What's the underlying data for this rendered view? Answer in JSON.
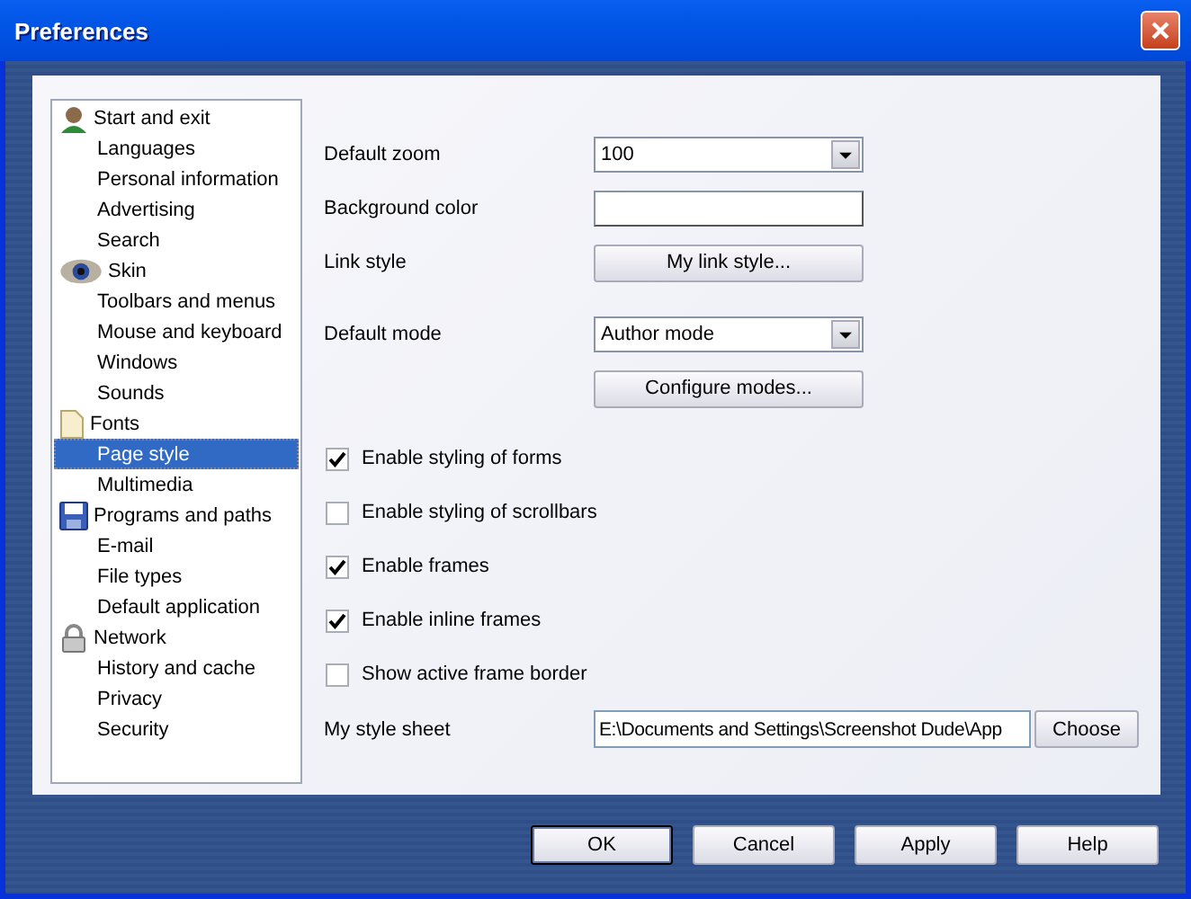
{
  "window": {
    "title": "Preferences"
  },
  "sidebar": {
    "items": [
      {
        "label": "Start and exit",
        "kind": "person",
        "selected": false
      },
      {
        "label": "Languages",
        "kind": "plain",
        "selected": false
      },
      {
        "label": "Personal information",
        "kind": "plain",
        "selected": false
      },
      {
        "label": "Advertising",
        "kind": "plain",
        "selected": false
      },
      {
        "label": "Search",
        "kind": "plain",
        "selected": false
      },
      {
        "label": "Skin",
        "kind": "eye",
        "selected": false
      },
      {
        "label": "Toolbars and menus",
        "kind": "plain",
        "selected": false
      },
      {
        "label": "Mouse and keyboard",
        "kind": "plain",
        "selected": false
      },
      {
        "label": "Windows",
        "kind": "plain",
        "selected": false
      },
      {
        "label": "Sounds",
        "kind": "plain",
        "selected": false
      },
      {
        "label": "Fonts",
        "kind": "page",
        "selected": false
      },
      {
        "label": "Page style",
        "kind": "plain",
        "selected": true
      },
      {
        "label": "Multimedia",
        "kind": "plain",
        "selected": false
      },
      {
        "label": "Programs and paths",
        "kind": "disk",
        "selected": false
      },
      {
        "label": "E-mail",
        "kind": "plain",
        "selected": false
      },
      {
        "label": "File types",
        "kind": "plain",
        "selected": false
      },
      {
        "label": "Default application",
        "kind": "plain",
        "selected": false
      },
      {
        "label": "Network",
        "kind": "lock",
        "selected": false
      },
      {
        "label": "History and cache",
        "kind": "plain",
        "selected": false
      },
      {
        "label": "Privacy",
        "kind": "plain",
        "selected": false
      },
      {
        "label": "Security",
        "kind": "plain",
        "selected": false
      }
    ]
  },
  "settings": [
    {
      "kind": "dropdown",
      "label": "Default zoom",
      "value": "100"
    },
    {
      "kind": "color",
      "label": "Background color"
    },
    {
      "kind": "button",
      "label": "Link style",
      "button": "My link style..."
    },
    {
      "kind": "dropdown",
      "label": "Default mode",
      "value": "Author mode"
    },
    {
      "kind": "button",
      "button": "Configure modes..."
    }
  ],
  "checkboxes": [
    {
      "label": "Enable styling of forms",
      "checked": true
    },
    {
      "label": "Enable styling of scrollbars",
      "checked": false
    },
    {
      "label": "Enable frames",
      "checked": true
    },
    {
      "label": "Enable inline frames",
      "checked": true
    },
    {
      "label": "Show active frame border",
      "checked": false
    }
  ],
  "style_sheet": {
    "label": "My style sheet",
    "value": "E:\\Documents and Settings\\Screenshot Dude\\App",
    "button": "Choose"
  },
  "buttons": [
    {
      "label": "OK",
      "default": true
    },
    {
      "label": "Cancel",
      "default": false
    },
    {
      "label": "Apply",
      "default": false
    },
    {
      "label": "Help",
      "default": false
    }
  ]
}
